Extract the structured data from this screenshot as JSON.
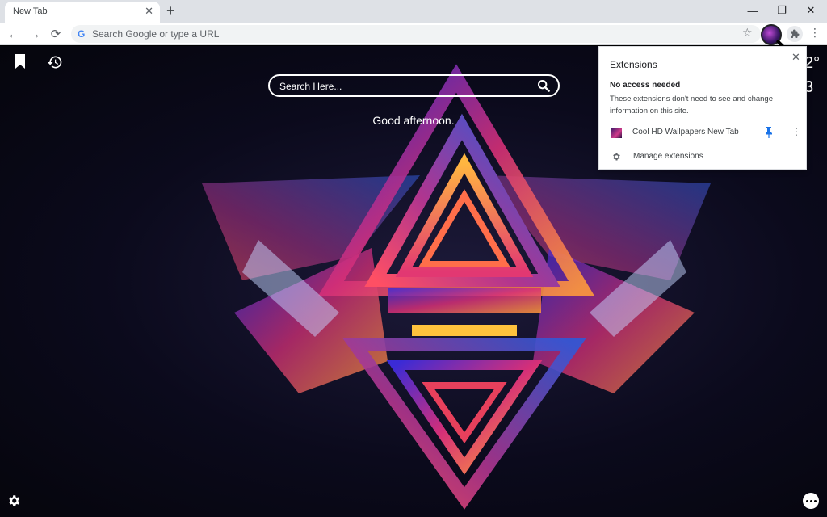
{
  "tab": {
    "title": "New Tab",
    "close": "✕"
  },
  "new_tab_label": "+",
  "window_controls": {
    "minimize": "—",
    "restore": "❐",
    "close": "✕"
  },
  "toolbar": {
    "back": "←",
    "forward": "→",
    "reload": "⟳",
    "omnibox_g": "G",
    "omnibox_placeholder": "Search Google or type a URL",
    "star": "☆",
    "menu": "⋮"
  },
  "page": {
    "search_placeholder": "Search Here...",
    "greeting": "Good afternoon.",
    "temp_partial": "2°",
    "date_partial": "3"
  },
  "extensions_popup": {
    "title": "Extensions",
    "close": "✕",
    "section_title": "No access needed",
    "section_desc": "These extensions don't need to see and change information on this site.",
    "extension_name": "Cool HD Wallpapers New Tab",
    "extension_more": "⋮",
    "manage_label": "Manage extensions"
  },
  "colors": {
    "accent_blue": "#1a73e8",
    "tabstrip": "#dee1e6",
    "omnibox": "#f1f3f4"
  }
}
